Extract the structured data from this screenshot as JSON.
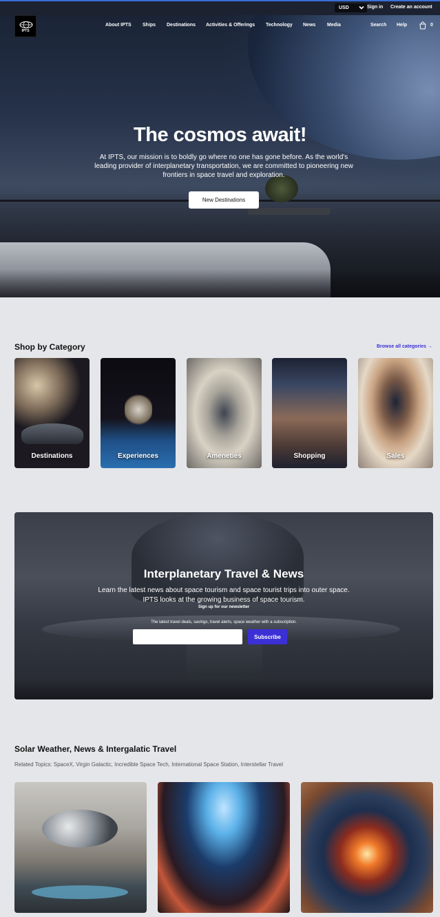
{
  "topbar": {
    "currency": "USD",
    "sign_in": "Sign in",
    "create_account": "Create an account"
  },
  "header": {
    "logo_text": "IPTS",
    "nav": [
      "About IPTS",
      "Ships",
      "Destinations",
      "Activities & Offerings",
      "Technology",
      "News",
      "Media"
    ],
    "search": "Search",
    "help": "Help",
    "cart_count": "0"
  },
  "hero": {
    "title": "The cosmos await!",
    "text": "At IPTS, our mission is to boldly go where no one has gone before. As the world's leading provider of interplanetary transportation, we are committed to pioneering new frontiers in space travel and exploration.",
    "button": "New Destinations"
  },
  "categories": {
    "title": "Shop by Category",
    "browse_link": "Browse all categories →",
    "items": [
      "Destinations",
      "Experiences",
      "Ameneties",
      "Shopping",
      "Sales"
    ]
  },
  "newsletter": {
    "title": "Interplanetary Travel & News",
    "text": "Learn the latest news about space tourism and space tourist trips into outer space. IPTS looks at the growing business of space tourism.",
    "signup_label": "Sign up for our newsletter",
    "note": "The latest travel deals, savings, travel alerts, space weather with a subscription.",
    "email_placeholder": "",
    "subscribe_button": "Subscribe"
  },
  "news": {
    "title": "Solar Weather, News & Intergalatic Travel",
    "topics": "Related Topics: SpaceX, Virgin Galactic, Incredible Space Tech, International Space Station, Interstellar Travel"
  },
  "colors": {
    "accent": "#3b30d6",
    "page_bg": "#e5e6ea",
    "topbar_bg": "#1c2230"
  }
}
